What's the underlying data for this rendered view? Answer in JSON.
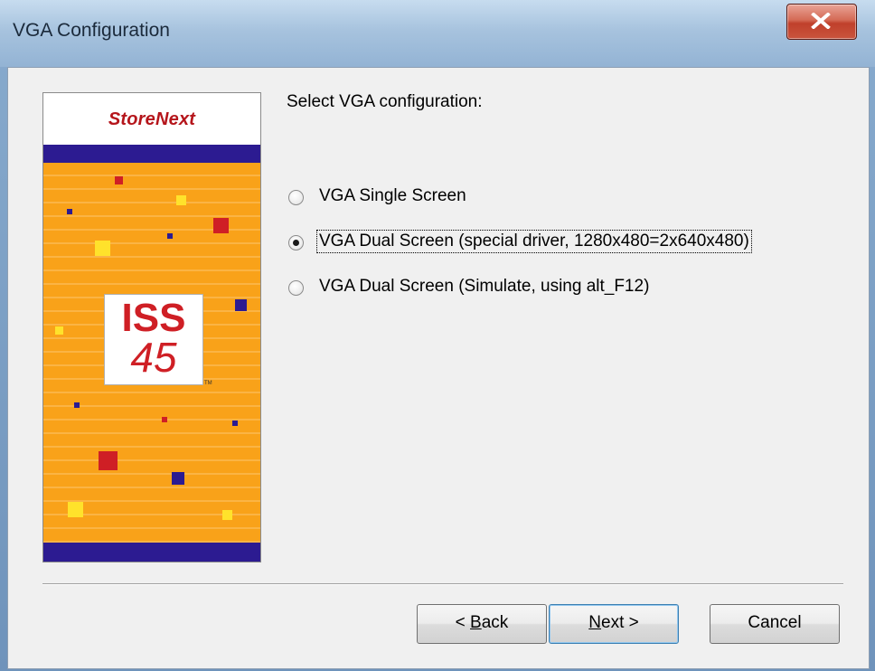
{
  "window": {
    "title": "VGA Configuration"
  },
  "branding": {
    "company_logo": "StoreNext",
    "product_logo_top": "ISS",
    "product_logo_bottom": "45",
    "trademark": "TM",
    "colors": {
      "orange": "#f9a219",
      "navy": "#2c1b91",
      "red": "#cf1f25",
      "yellow": "#ffe22b"
    }
  },
  "prompt": "Select VGA configuration:",
  "options": [
    {
      "label": "VGA Single Screen",
      "selected": false
    },
    {
      "label": "VGA Dual Screen (special driver, 1280x480=2x640x480)",
      "selected": true
    },
    {
      "label": "VGA Dual Screen (Simulate, using alt_F12)",
      "selected": false
    }
  ],
  "buttons": {
    "back": {
      "prefix": "< ",
      "mnemonic": "B",
      "rest": "ack"
    },
    "next": {
      "mnemonic": "N",
      "rest": "ext >"
    },
    "cancel": "Cancel"
  },
  "icons": {
    "close": "close-icon",
    "radio": "radio-button-icon"
  }
}
